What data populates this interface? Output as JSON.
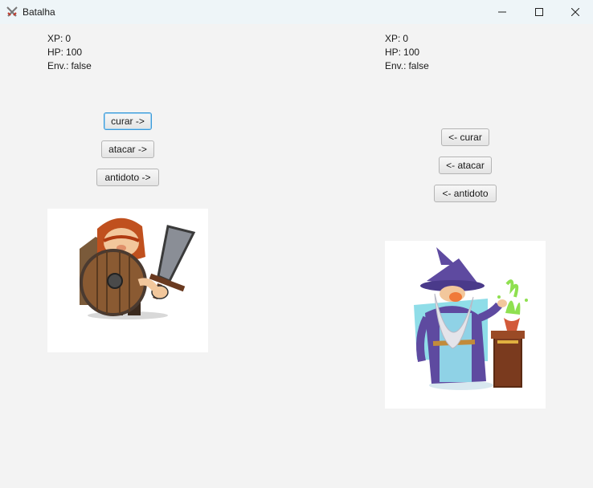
{
  "window": {
    "title": "Batalha"
  },
  "player_left": {
    "xp_label": "XP:",
    "xp": "0",
    "hp_label": "HP:",
    "hp": "100",
    "env_label": "Env.:",
    "env": "false",
    "buttons": {
      "heal": "curar ->",
      "attack": "atacar ->",
      "antidote": "antidoto ->"
    },
    "character": "dwarf-warrior"
  },
  "player_right": {
    "xp_label": "XP:",
    "xp": "0",
    "hp_label": "HP:",
    "hp": "100",
    "env_label": "Env.:",
    "env": "false",
    "buttons": {
      "heal": "<- curar",
      "attack": "<- atacar",
      "antidote": "<- antidoto"
    },
    "character": "wizard-alchemist"
  },
  "icons": {
    "app": "crossed-swords-icon",
    "minimize": "minimize-icon",
    "maximize": "maximize-icon",
    "close": "close-icon"
  }
}
